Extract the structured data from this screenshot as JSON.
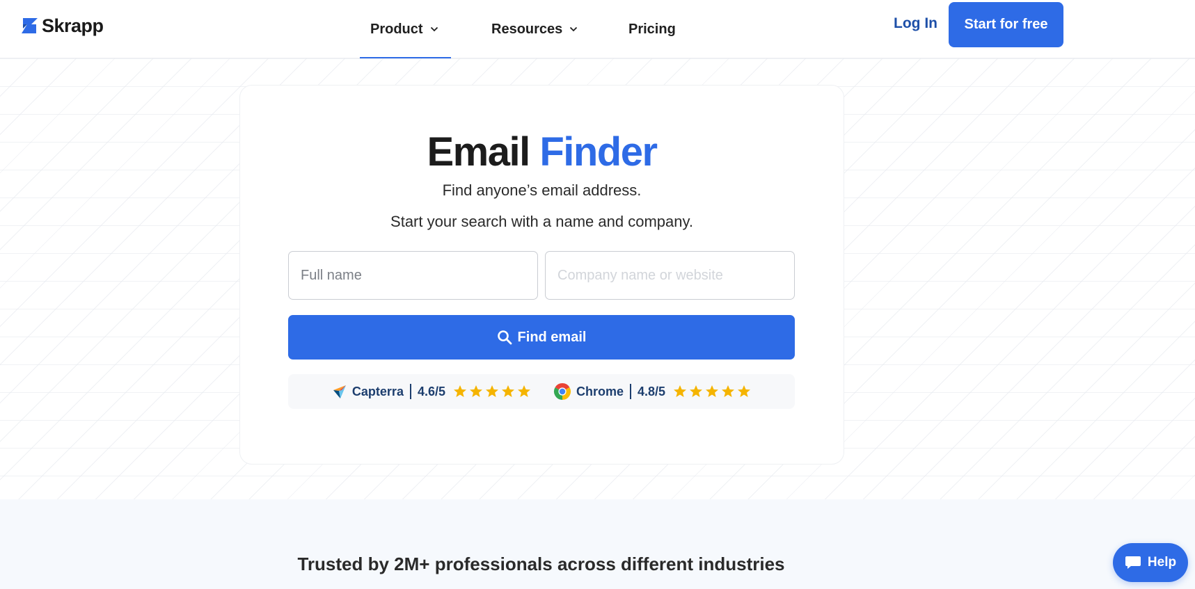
{
  "brand": {
    "name": "Skrapp",
    "logo_icon": "skrapp-logo-mark",
    "accent": "#2e6be6"
  },
  "nav": {
    "items": [
      {
        "label": "Product",
        "dropdown": true,
        "active": true
      },
      {
        "label": "Resources",
        "dropdown": true,
        "active": false
      },
      {
        "label": "Pricing",
        "dropdown": false,
        "active": false
      }
    ],
    "login_label": "Log In",
    "cta_label": "Start for free"
  },
  "hero": {
    "title_main": "Email",
    "title_accent": "Finder",
    "subtitle_1": "Find anyone’s email address.",
    "subtitle_2": "Start your search with a name and company.",
    "name_placeholder": "Full name",
    "company_placeholder": "Company name or website",
    "button_label": "Find email",
    "button_icon": "search-icon"
  },
  "ratings": [
    {
      "name": "Capterra",
      "score": "4.6/5",
      "stars": 5,
      "icon": "capterra-logo"
    },
    {
      "name": "Chrome",
      "score": "4.8/5",
      "stars": 5,
      "icon": "chrome-logo"
    }
  ],
  "trusted_text": "Trusted by 2M+ professionals across different industries",
  "help": {
    "label": "Help",
    "icon": "chat-bubble-icon"
  },
  "colors": {
    "primary": "#2e6be6",
    "navy": "#1d3e6e",
    "star": "#f5b400"
  }
}
